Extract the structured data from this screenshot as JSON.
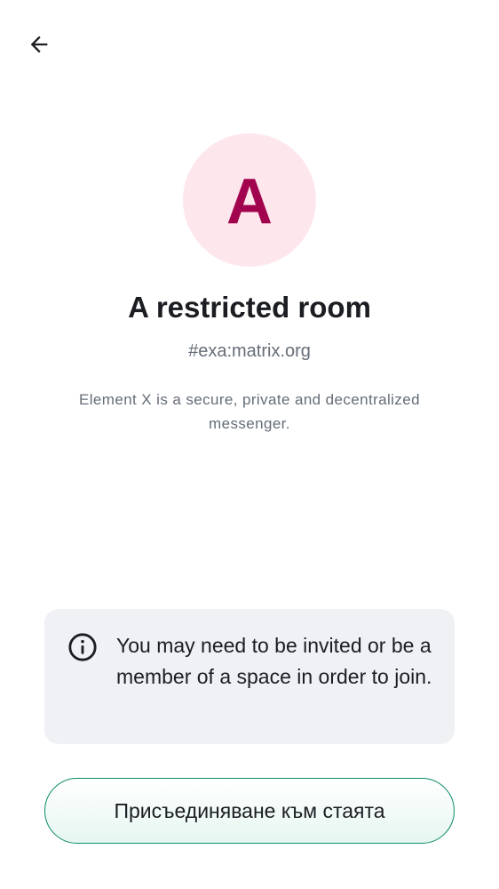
{
  "nav": {
    "back_icon": "arrow-left-icon"
  },
  "room": {
    "avatar_letter": "A",
    "avatar_bg": "#fde6ec",
    "avatar_fg": "#a1034f",
    "title": "A restricted room",
    "alias": "#exa:matrix.org",
    "topic": "Element X is a secure, private and decentralized messenger."
  },
  "notice": {
    "icon": "info-icon",
    "text": "You may need to be invited or be a member of a space in order to join."
  },
  "actions": {
    "join_label": "Присъединяване към стаята",
    "accent": "#0b8b6a"
  }
}
